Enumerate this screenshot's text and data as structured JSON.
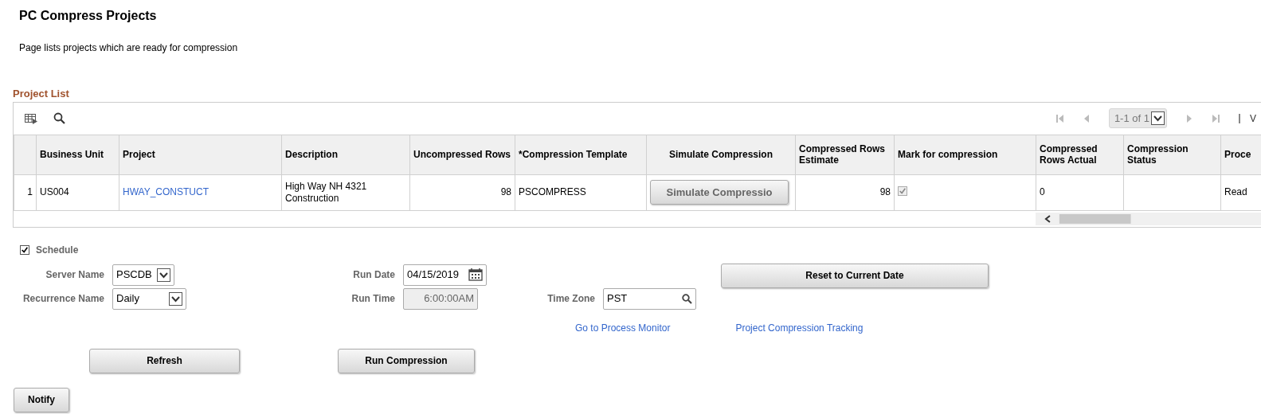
{
  "title": "PC Compress Projects",
  "description": "Page lists projects which are ready for compression",
  "project_list": {
    "title": "Project List",
    "pager": "1-1 of 1",
    "trailing_text": "V",
    "columns": [
      "Business Unit",
      "Project",
      "Description",
      "Uncompressed Rows",
      "*Compression Template",
      "Simulate Compression",
      "Compressed Rows Estimate",
      "Mark for compression",
      "Compressed Rows Actual",
      "Compression Status",
      "Proce"
    ],
    "rows": [
      {
        "row_number": "1",
        "cells": [
          {
            "kind": "text",
            "text": "US004"
          },
          {
            "kind": "link",
            "text": "HWAY_CONSTUCT"
          },
          {
            "kind": "text",
            "text": "High Way NH 4321 Construction"
          },
          {
            "kind": "number",
            "text": "98"
          },
          {
            "kind": "text",
            "text": "PSCOMPRESS"
          },
          {
            "kind": "button",
            "text": "Simulate Compressio",
            "disabled": true
          },
          {
            "kind": "number",
            "text": "98"
          },
          {
            "kind": "checkbox",
            "checked": true,
            "disabled": true
          },
          {
            "kind": "text",
            "text": "0"
          },
          {
            "kind": "empty"
          },
          {
            "kind": "text",
            "text": "Read"
          }
        ]
      }
    ]
  },
  "schedule": {
    "label": "Schedule",
    "checked": true
  },
  "server_name": {
    "label": "Server Name",
    "value": "PSCDB"
  },
  "run_date": {
    "label": "Run Date",
    "value": "04/15/2019"
  },
  "reset_button": "Reset to Current Date",
  "recurrence_name": {
    "label": "Recurrence Name",
    "value": "Daily"
  },
  "run_time": {
    "label": "Run Time",
    "value": "6:00:00AM",
    "disabled": true
  },
  "time_zone": {
    "label": "Time Zone",
    "value": "PST"
  },
  "links": [
    "Go to Process Monitor",
    "Project Compression Tracking"
  ],
  "buttons": [
    "Refresh",
    "Run Compression"
  ],
  "notify_button": "Notify"
}
